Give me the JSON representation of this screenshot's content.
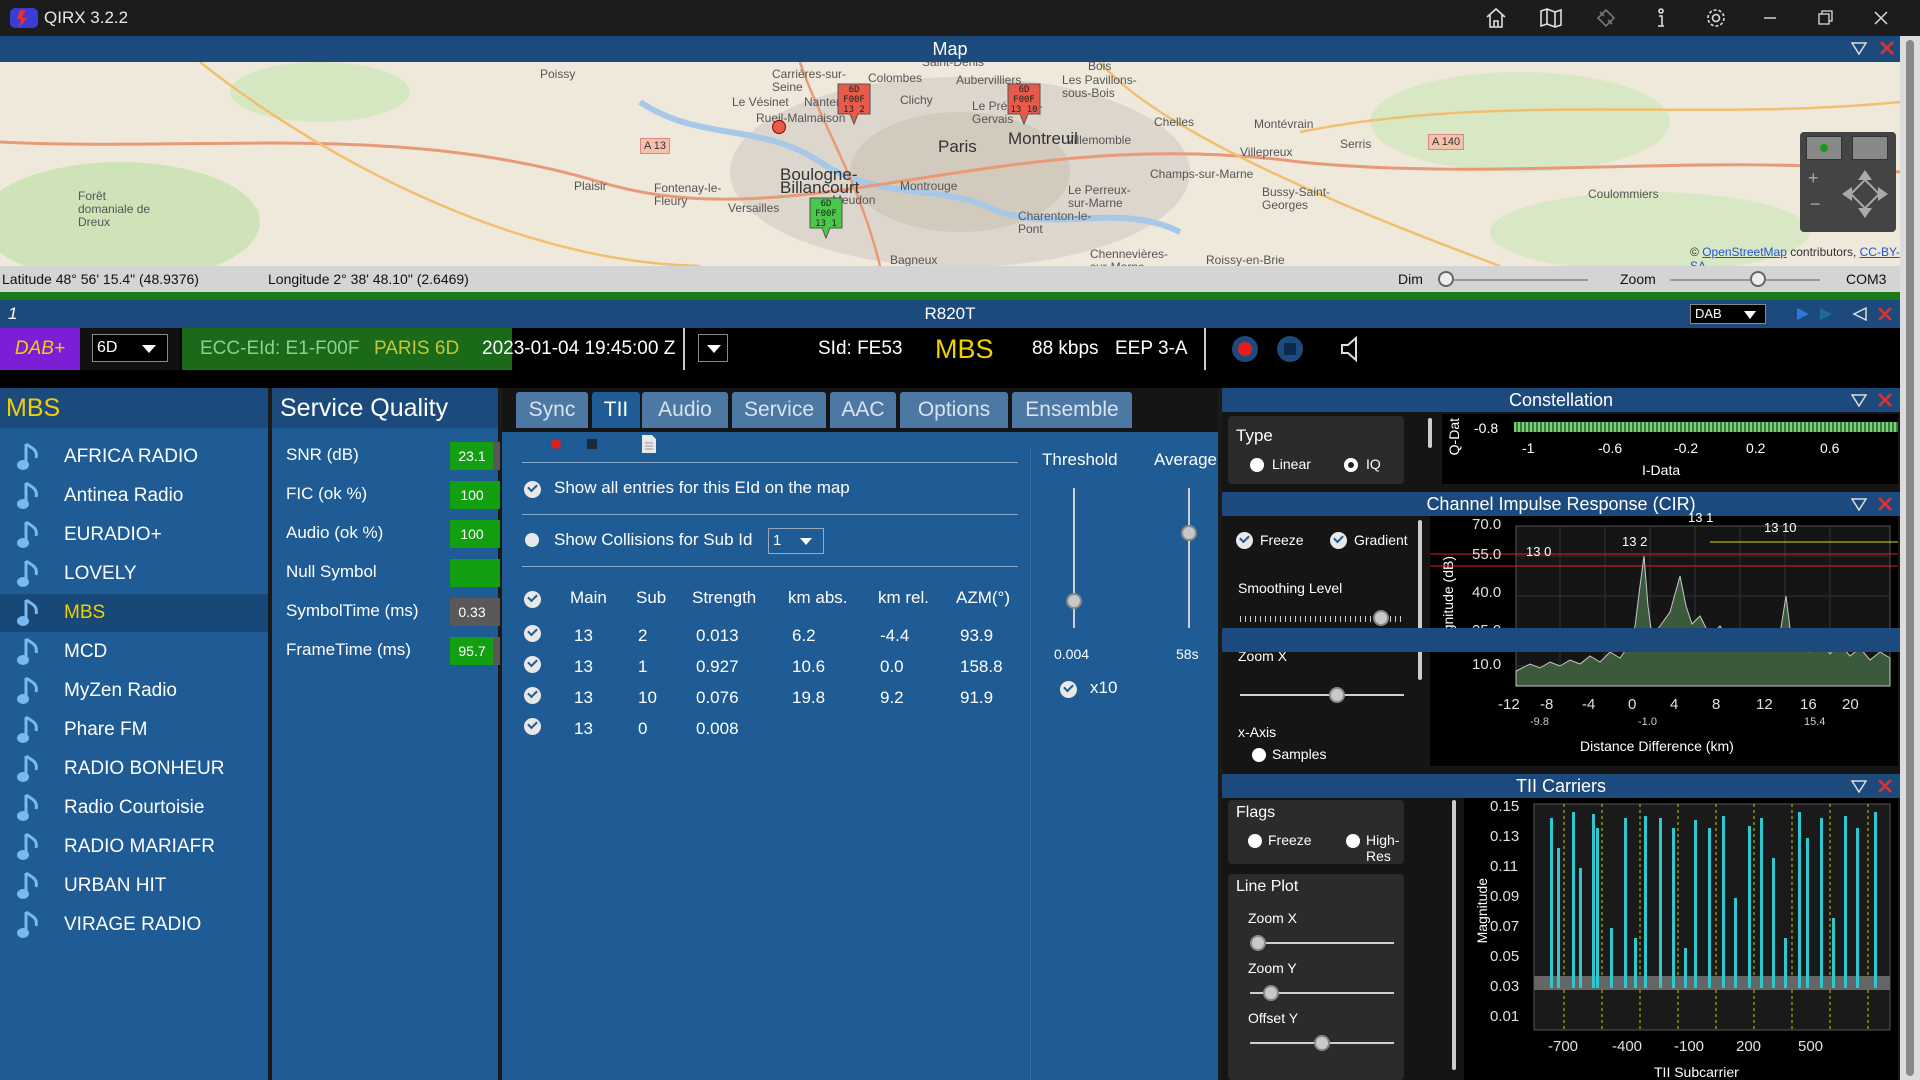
{
  "app": {
    "title": "QIRX 3.2.2"
  },
  "titlebar_icons": [
    "home-icon",
    "map-icon",
    "satellite-icon",
    "info-icon",
    "settings-icon",
    "minimize-icon",
    "maximize-icon",
    "close-icon"
  ],
  "map": {
    "header": "Map",
    "place_labels": [
      "Poissy",
      "Carrières-sur-Seine",
      "Colombes",
      "Saint-Denis",
      "Aubervilliers",
      "Les Pavillons-sous-Bois",
      "Bois",
      "Le Vésinet",
      "Nanterre",
      "Clichy",
      "Rueil-Malmaison",
      "Le Pré-Saint-Gervais",
      "Villemomble",
      "Chelles",
      "Montévrain",
      "Paris",
      "Montreuil",
      "Champs-sur-Marne",
      "Serris",
      "Villepreux",
      "Boulogne-Billancourt",
      "Le Perreux-sur-Marne",
      "Bussy-Saint-Georges",
      "Plaisir",
      "Fontenay-le-Fleury",
      "Versailles",
      "Meudon",
      "Montrouge",
      "Charenton-le-Pont",
      "Forêt domaniale de Dreux",
      "Coulommiers",
      "Bagneux",
      "Chennevières-sur-Marne",
      "Roissy-en-Brie"
    ],
    "road_labels": [
      "A 13",
      "A 140"
    ],
    "markers": [
      {
        "label": "6D F00F 13 2"
      },
      {
        "label": "6D F00F 13 10"
      },
      {
        "label": "6D F00F 13 1"
      }
    ],
    "attribution_prefix": "©",
    "attribution_link": "OpenStreetMap",
    "attribution_mid": "contributors,",
    "attribution_license": "CC-BY-SA",
    "latitude": "Latitude  48° 56' 15.4\" (48.9376)",
    "longitude": "Longitude  2° 38' 48.10\" (2.6469)",
    "dim_label": "Dim",
    "zoom_label": "Zoom",
    "com_port": "COM3",
    "dim_level": 0.0,
    "zoom_level": 0.6
  },
  "receiver": {
    "index": "1",
    "name": "R820T",
    "mode_select": "DAB"
  },
  "control": {
    "dab_label": "DAB+",
    "channel": "6D",
    "ecc_eid": "ECC-EId: E1-F00F",
    "ensemble": "PARIS 6D",
    "datetime": "2023-01-04  19:45:00 Z",
    "sid": "SId: FE53",
    "service": "MBS",
    "bitrate": "88 kbps",
    "protection": "EEP 3-A"
  },
  "services": {
    "header": "MBS",
    "items": [
      "AFRICA RADIO",
      "Antinea Radio",
      "EURADIO+",
      "LOVELY",
      "MBS",
      "MCD",
      "MyZen Radio",
      "Phare FM",
      "RADIO BONHEUR",
      "Radio Courtoisie",
      "RADIO MARIAFR",
      "URBAN HIT",
      "VIRAGE RADIO"
    ],
    "selected": "MBS"
  },
  "quality": {
    "header": "Service Quality",
    "rows": [
      {
        "label": "SNR (dB)",
        "value": "23.1",
        "fill": 0.85
      },
      {
        "label": "FIC (ok %)",
        "value": "100",
        "fill": 1.0
      },
      {
        "label": "Audio (ok %)",
        "value": "100",
        "fill": 1.0
      },
      {
        "label": "Null Symbol",
        "value": "",
        "fill": 1.0
      },
      {
        "label": "SymbolTime (ms)",
        "value": "0.33",
        "fill": 0.0
      },
      {
        "label": "FrameTime (ms)",
        "value": "95.7",
        "fill": 0.85
      }
    ]
  },
  "tabs": {
    "items": [
      "Sync",
      "TII",
      "Audio",
      "Service",
      "AAC",
      "Options",
      "Ensemble"
    ],
    "active": "TII",
    "tii": {
      "show_all": "Show all entries for this EId on the map",
      "show_collisions": "Show Collisions for Sub Id",
      "sub_id_value": "1",
      "threshold_label": "Threshold",
      "threshold_value": "0.004",
      "average_label": "Average",
      "average_value": "58s",
      "x10_label": "x10",
      "threshold_level": 0.15,
      "average_level": 0.7,
      "columns": [
        "Main",
        "Sub",
        "Strength",
        "km abs.",
        "km rel.",
        "AZM(°)"
      ],
      "rows": [
        [
          "13",
          "2",
          "0.013",
          "6.2",
          "-4.4",
          "93.9"
        ],
        [
          "13",
          "1",
          "0.927",
          "10.6",
          "0.0",
          "158.8"
        ],
        [
          "13",
          "10",
          "0.076",
          "19.8",
          "9.2",
          "91.9"
        ],
        [
          "13",
          "0",
          "0.008",
          "",
          "",
          ""
        ]
      ]
    }
  },
  "constellation": {
    "header": "Constellation",
    "type_label": "Type",
    "linear_label": "Linear",
    "iq_label": "IQ",
    "ylabel": "Q-Dat",
    "xlabel": "I-Data",
    "y_tick": "-0.8",
    "x_ticks": [
      "-1",
      "-0.6",
      "-0.2",
      "0.2",
      "0.6"
    ]
  },
  "cir": {
    "header": "Channel Impulse Response (CIR)",
    "freeze_label": "Freeze",
    "gradient_label": "Gradient",
    "smoothing_label": "Smoothing Level",
    "zoomx_label": "Zoom X",
    "xaxis_label": "x-Axis",
    "samples_label": "Samples",
    "smoothing_level": 0.9,
    "zoomx_level": 0.6,
    "ylabel": "Magnitude (dB)",
    "xlabel": "Distance Difference (km)",
    "y_ticks": [
      "70.0",
      "55.0",
      "40.0",
      "25.0",
      "10.0"
    ],
    "x_ticks": [
      "-12",
      "-8",
      "-4",
      "0",
      "4",
      "8",
      "12",
      "16",
      "20"
    ],
    "annotations": [
      "13 0",
      "13 2",
      "13 1",
      "13 10"
    ],
    "sub_ticks": [
      "-9.8",
      "-1.0",
      "15.4"
    ]
  },
  "tii_carriers": {
    "header": "TII Carriers",
    "flags_label": "Flags",
    "freeze_label": "Freeze",
    "highres_label": "High-Res",
    "lineplot_label": "Line Plot",
    "zoomx_label": "Zoom X",
    "zoomy_label": "Zoom Y",
    "offsety_label": "Offset Y",
    "zoomx_level": 0.0,
    "zoomy_level": 0.1,
    "offsety_level": 0.5,
    "ylabel": "Magnitude",
    "xlabel": "TII Subcarrier",
    "y_ticks": [
      "0.15",
      "0.13",
      "0.11",
      "0.09",
      "0.07",
      "0.05",
      "0.03",
      "0.01"
    ],
    "x_ticks": [
      "-700",
      "-400",
      "-100",
      "200",
      "500"
    ]
  },
  "colors": {
    "panel": "#1f5b94",
    "header": "#1d4a7c",
    "green": "#12a012",
    "gold": "#f0d000",
    "accent": "#7a1fd6"
  }
}
